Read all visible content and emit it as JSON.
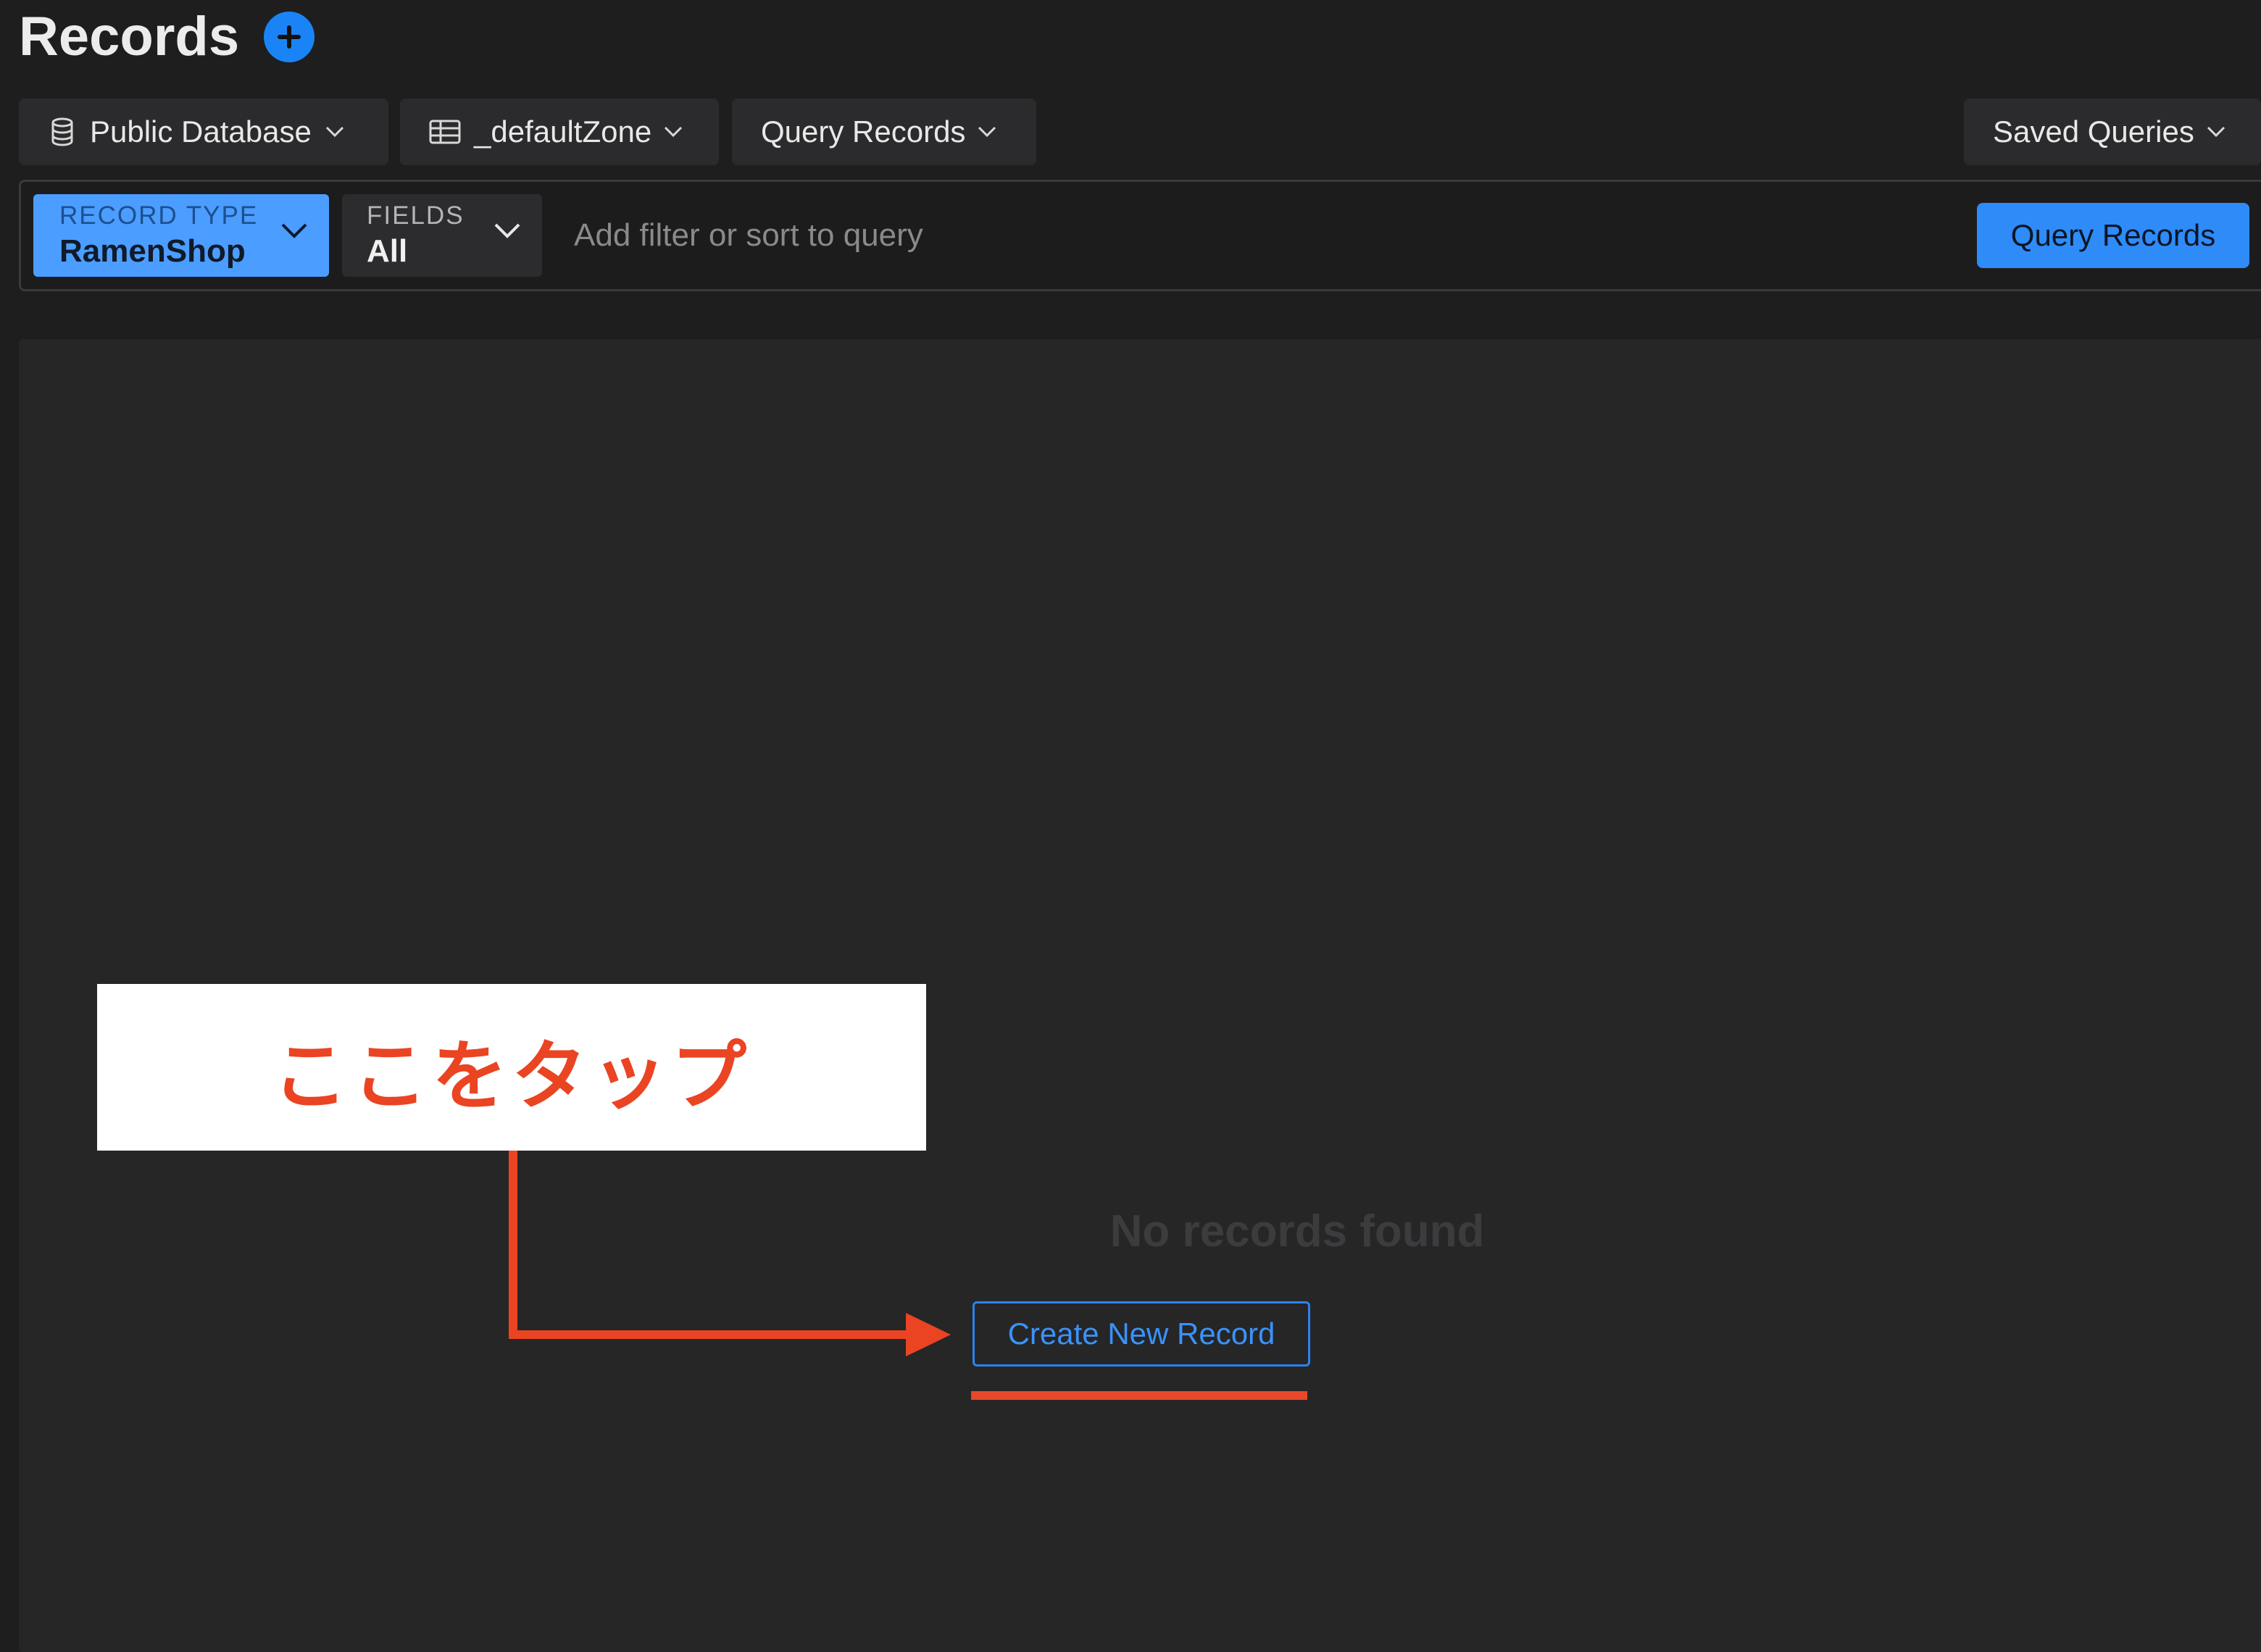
{
  "header": {
    "title": "Records",
    "add_icon": "plus-circle-icon"
  },
  "toolbar": {
    "database": {
      "label": "Public Database",
      "icon": "database-icon"
    },
    "zone": {
      "label": "_defaultZone",
      "icon": "table-icon"
    },
    "query_mode": {
      "label": "Query Records"
    },
    "saved_queries": {
      "label": "Saved Queries"
    }
  },
  "filter": {
    "record_type_caption": "RECORD TYPE",
    "record_type_value": "RamenShop",
    "fields_caption": "FIELDS",
    "fields_value": "All",
    "placeholder": "Add filter or sort to query",
    "query_button": "Query Records"
  },
  "results": {
    "empty_message": "No records found",
    "create_button": "Create New Record"
  },
  "annotation": {
    "callout_text": "ここをタップ",
    "color": "#ea4423"
  },
  "colors": {
    "accent": "#2e8bf8",
    "background": "#1e1e1f",
    "panel": "#262627"
  }
}
